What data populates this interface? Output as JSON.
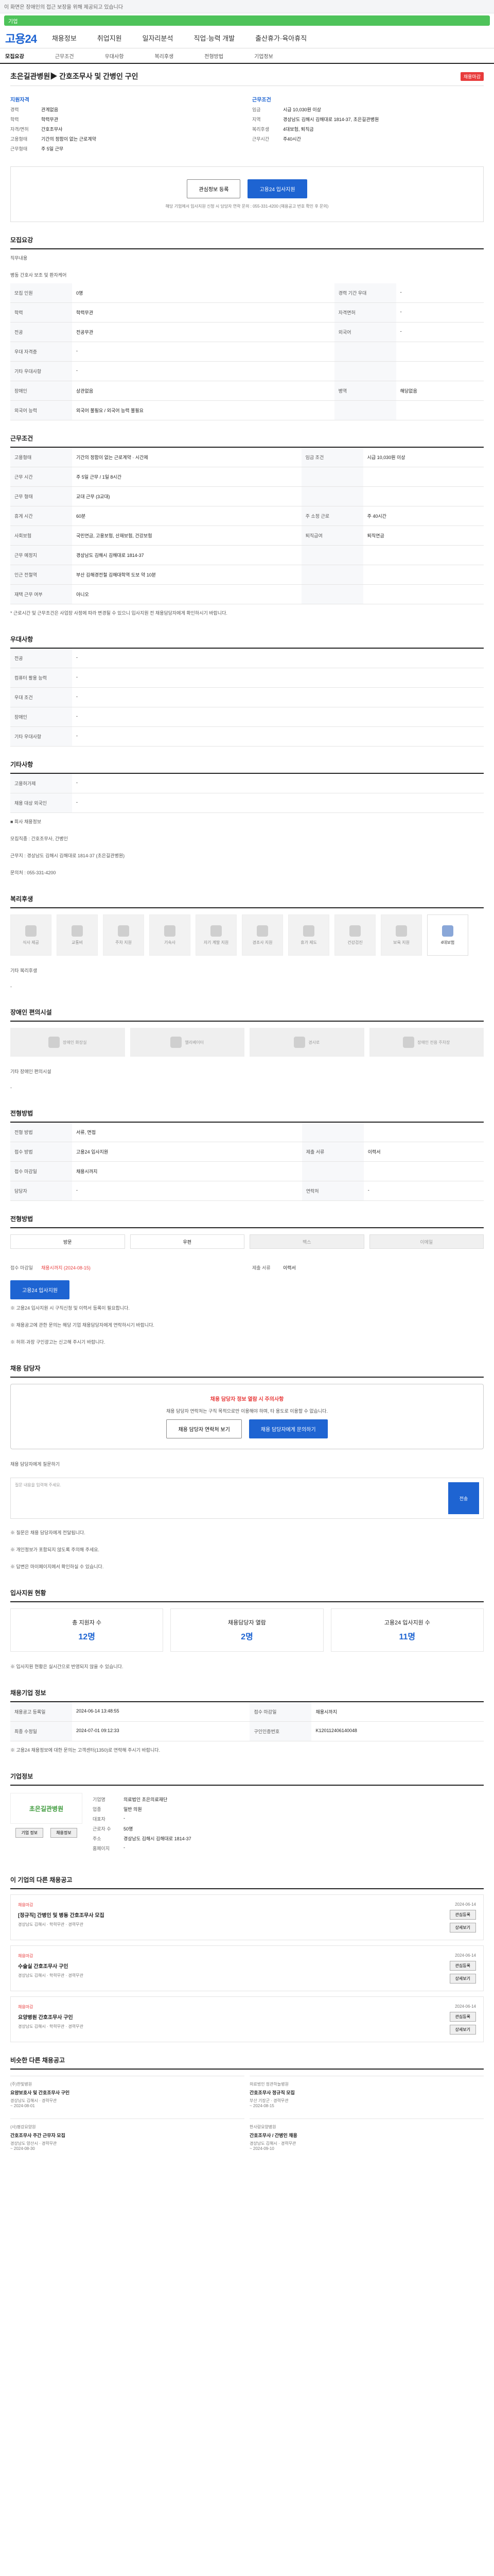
{
  "topbar": {
    "text": "이 화면은 장애인의 접근 보장을 위해 제공되고 있습니다"
  },
  "searchbar": {
    "label": "기업"
  },
  "header": {
    "logo": "고용24",
    "menu": [
      "채용정보",
      "취업지원",
      "일자리분석",
      "직업·능력 개발",
      "출산휴가·육아휴직"
    ]
  },
  "tabs": [
    "모집요강",
    "근무조건",
    "우대사항",
    "복리후생",
    "전형방법",
    "기업정보"
  ],
  "job": {
    "title": "초은길관병원▶ 간호조무사 및 간병인 구인",
    "tag": "채용마감",
    "qual_head": "지원자격",
    "cond_head": "근무조건",
    "qual": [
      {
        "k": "경력",
        "v": "관계없음"
      },
      {
        "k": "학력",
        "v": "학력무관"
      },
      {
        "k": "자격/면허",
        "v": "간호조무사"
      },
      {
        "k": "고용형태",
        "v": "기간의 정함이 없는 근로계약"
      },
      {
        "k": "근무형태",
        "v": "주 5일 근무"
      }
    ],
    "cond": [
      {
        "k": "임금",
        "v": "시급 10,030원 이상"
      },
      {
        "k": "지역",
        "v": "경상남도 김해시 김해대로 1814-37, 초은길관병원"
      },
      {
        "k": "복리후생",
        "v": "4대보험, 퇴직금"
      },
      {
        "k": "근무시간",
        "v": "주40시간"
      }
    ]
  },
  "apply": {
    "btn_save": "관심정보 등록",
    "btn_apply": "고용24 입사지원",
    "note": "해당 기업에서 입사지원 신청 시 담당자 연락 문의 : 055-331-4200 (채용공고 번호 확인 후 문의)"
  },
  "recruit": {
    "title": "모집요강",
    "duty_label": "직무내용",
    "duty": "병동 간호사 보조 및 환자케어",
    "rows": [
      {
        "h": "모집 인원",
        "v": "0명",
        "h2": "경력 기간 우대",
        "v2": "-"
      },
      {
        "h": "학력",
        "v": "학력무관",
        "h2": "자격면허",
        "v2": "-"
      },
      {
        "h": "전공",
        "v": "전공무관",
        "h2": "외국어",
        "v2": "-"
      },
      {
        "h": "우대 자격증",
        "v": "-",
        "h2": "",
        "v2": ""
      },
      {
        "h": "기타 우대사항",
        "v": "-",
        "h2": "",
        "v2": ""
      },
      {
        "h": "장애인",
        "v": "상관없음",
        "h2": "병역",
        "v2": "해당없음"
      },
      {
        "h": "외국어 능력",
        "v": "외국어 불필요 / 외국어 능력 불필요",
        "h2": "",
        "v2": ""
      }
    ]
  },
  "work": {
    "title": "근무조건",
    "rows": [
      {
        "h": "고용형태",
        "v": "기간의 정함이 없는 근로계약 · 시간제",
        "h2": "임금 조건",
        "v2": "시급 10,030원 이상"
      },
      {
        "h": "근무 시간",
        "v": "주 5일 근무 / 1일 8시간",
        "h2": "",
        "v2": ""
      },
      {
        "h": "근무 형태",
        "v": "교대 근무 (3교대)",
        "h2": "",
        "v2": ""
      },
      {
        "h": "휴게 시간",
        "v": "60분",
        "h2": "주 소정 근로",
        "v2": "주 40시간"
      },
      {
        "h": "사회보험",
        "v": "국민연금, 고용보험, 산재보험, 건강보험",
        "h2": "퇴직급여",
        "v2": "퇴직연금"
      },
      {
        "h": "근무 예정지",
        "v": "경상남도 김해시 김해대로 1814-37",
        "h2": "",
        "v2": ""
      },
      {
        "h": "인근 전철역",
        "v": "부산 김해경전철 김해대학역 도보 약 10분",
        "h2": "",
        "v2": ""
      },
      {
        "h": "재택 근무 여부",
        "v": "아니오",
        "h2": "",
        "v2": ""
      }
    ],
    "note": "* 근로시간 및 근무조건은 사업장 사정에 따라 변경될 수 있으니 입사지원 전 채용담당자에게 확인하시기 바랍니다."
  },
  "prefer": {
    "title": "우대사항",
    "rows": [
      {
        "h": "전공",
        "v": "-"
      },
      {
        "h": "컴퓨터 활용 능력",
        "v": "-"
      },
      {
        "h": "우대 조건",
        "v": "-"
      },
      {
        "h": "장애인",
        "v": "-"
      },
      {
        "h": "기타 우대사항",
        "v": "-"
      }
    ]
  },
  "etc": {
    "title": "기타사항",
    "rows": [
      {
        "h": "고용허가제",
        "v": "-"
      },
      {
        "h": "채용 대상 외국인",
        "v": "-"
      }
    ],
    "box_title": "■ 회사 채용정보",
    "box_lines": [
      "모집직종 : 간호조무사, 간병인",
      "근무지 : 경상남도 김해시 김해대로 1814-37 (초은길관병원)",
      "문의처 : 055-331-4200"
    ]
  },
  "welfare": {
    "title": "복리후생",
    "items": [
      {
        "name": "식사 제공",
        "on": false
      },
      {
        "name": "교통비",
        "on": false
      },
      {
        "name": "주차 지원",
        "on": false
      },
      {
        "name": "기숙사",
        "on": false
      },
      {
        "name": "자기 계발 지원",
        "on": false
      },
      {
        "name": "경조사 지원",
        "on": false
      },
      {
        "name": "휴가 제도",
        "on": false
      },
      {
        "name": "건강검진",
        "on": false
      },
      {
        "name": "보육 지원",
        "on": false
      },
      {
        "name": "4대보험",
        "on": true
      }
    ],
    "note_label": "기타 복리후생",
    "note": "-"
  },
  "disabled": {
    "title": "장애인 편의시설",
    "items": [
      "장애인 화장실",
      "엘리베이터",
      "경사로",
      "장애인 전용 주차장"
    ],
    "note_label": "기타 장애인 편의시설",
    "note": "-"
  },
  "method": {
    "title": "전형방법",
    "rows": [
      {
        "h": "전형 방법",
        "v": "서류, 면접",
        "h2": "",
        "v2": ""
      },
      {
        "h": "접수 방법",
        "v": "고용24 입사지원",
        "h2": "제출 서류",
        "v2": "이력서"
      },
      {
        "h": "접수 마감일",
        "v": "채용시까지",
        "h2": "",
        "v2": ""
      },
      {
        "h": "담당자",
        "v": "-",
        "h2": "연락처",
        "v2": "-"
      }
    ]
  },
  "applyway": {
    "title": "전형방법",
    "items": [
      {
        "name": "방문",
        "off": false
      },
      {
        "name": "우편",
        "off": false
      },
      {
        "name": "팩스",
        "off": true
      },
      {
        "name": "이메일",
        "off": true
      }
    ],
    "deadline_label": "접수 마감일",
    "deadline": "채용시까지 (2024-08-15)",
    "docs_label": "제출 서류",
    "docs": "이력서",
    "apply_btn": "고용24 입사지원",
    "notes": [
      "※ 고용24 입사지원 시 구직신청 및 이력서 등록이 필요합니다.",
      "※ 채용공고에 관한 문의는 해당 기업 채용담당자에게 연락하시기 바랍니다.",
      "※ 허위·과장 구인광고는 신고해 주시기 바랍니다."
    ]
  },
  "qna": {
    "title": "채용 담당자",
    "warn": "채용 담당자 정보 열람 시 주의사항",
    "desc": "채용 담당자 연락처는 구직 목적으로만 이용해야 하며, 타 용도로 이용할 수 없습니다.",
    "btn1": "채용 담당자 연락처 보기",
    "btn2": "채용 담당자에게 문의하기",
    "q_label": "채용 담당자에게 질문하기",
    "q_placeholder": "질문 내용을 입력해 주세요.",
    "send": "전송",
    "notes": [
      "※ 질문은 채용 담당자에게 전달됩니다.",
      "※ 개인정보가 포함되지 않도록 주의해 주세요.",
      "※ 답변은 마이페이지에서 확인하실 수 있습니다."
    ]
  },
  "stats": {
    "title": "입사지원 현황",
    "items": [
      {
        "label": "총 지원자 수",
        "n": "12명"
      },
      {
        "label": "채용담당자 열람",
        "n": "2명"
      },
      {
        "label": "고용24 입사지원 수",
        "n": "11명"
      }
    ],
    "note": "※ 입사지원 현황은 실시간으로 반영되지 않을 수 있습니다."
  },
  "info": {
    "title": "채용기업 정보",
    "rows": [
      {
        "h": "채용공고 등록일",
        "v": "2024-06-14 13:48:55",
        "h2": "접수 마감일",
        "v2": "채용시까지"
      },
      {
        "h": "최종 수정일",
        "v": "2024-07-01 09:12:33",
        "h2": "구인인증번호",
        "v2": "K120112406140048"
      }
    ],
    "note": "※ 고용24 채용정보에 대한 문의는 고객센터(1350)로 연락해 주시기 바랍니다."
  },
  "company": {
    "title": "기업정보",
    "logo_text": "초은길관병원",
    "rows": [
      {
        "k": "기업명",
        "v": "의료법인 초은의료재단"
      },
      {
        "k": "업종",
        "v": "일반 의원"
      },
      {
        "k": "대표자",
        "v": "-"
      },
      {
        "k": "근로자 수",
        "v": "50명"
      },
      {
        "k": "주소",
        "v": "경상남도 김해시 김해대로 1814-37"
      },
      {
        "k": "홈페이지",
        "v": "-"
      }
    ],
    "btn1": "기업 정보",
    "btn2": "채용정보"
  },
  "related": {
    "title": "이 기업의 다른 채용공고",
    "items": [
      {
        "badge": "채용마감",
        "t": "[정규직] 간병인 및 병동 간호조무사 모집",
        "m": "경상남도 김해시 · 학력무관 · 경력무관",
        "d": "2024-06-14"
      },
      {
        "badge": "채용마감",
        "t": "수술실 간호조무사 구인",
        "m": "경상남도 김해시 · 학력무관 · 경력무관",
        "d": "2024-06-14"
      },
      {
        "badge": "채용마감",
        "t": "요양병원 간호조무사 구인",
        "m": "경상남도 김해시 · 학력무관 · 경력무관",
        "d": "2024-06-14"
      }
    ],
    "save": "관심등록",
    "view": "상세보기"
  },
  "similar": {
    "title": "비슷한 다른 채용공고",
    "items": [
      {
        "c": "(주)한빛병원",
        "t": "요양보호사 및 간호조무사 구인",
        "m": "경상남도 김해시 · 경력무관",
        "d": "~ 2024-08-01"
      },
      {
        "c": "의료법인 정관하늘병원",
        "t": "간호조무사 정규직 모집",
        "m": "부산 기장군 · 경력무관",
        "d": "~ 2024-08-15"
      },
      {
        "c": "(사)평강요양원",
        "t": "간호조무사 주간 근무자 모집",
        "m": "경상남도 양산시 · 경력무관",
        "d": "~ 2024-08-30"
      },
      {
        "c": "한사랑요양병원",
        "t": "간호조무사 / 간병인 채용",
        "m": "경상남도 김해시 · 경력무관",
        "d": "~ 2024-09-10"
      }
    ]
  }
}
